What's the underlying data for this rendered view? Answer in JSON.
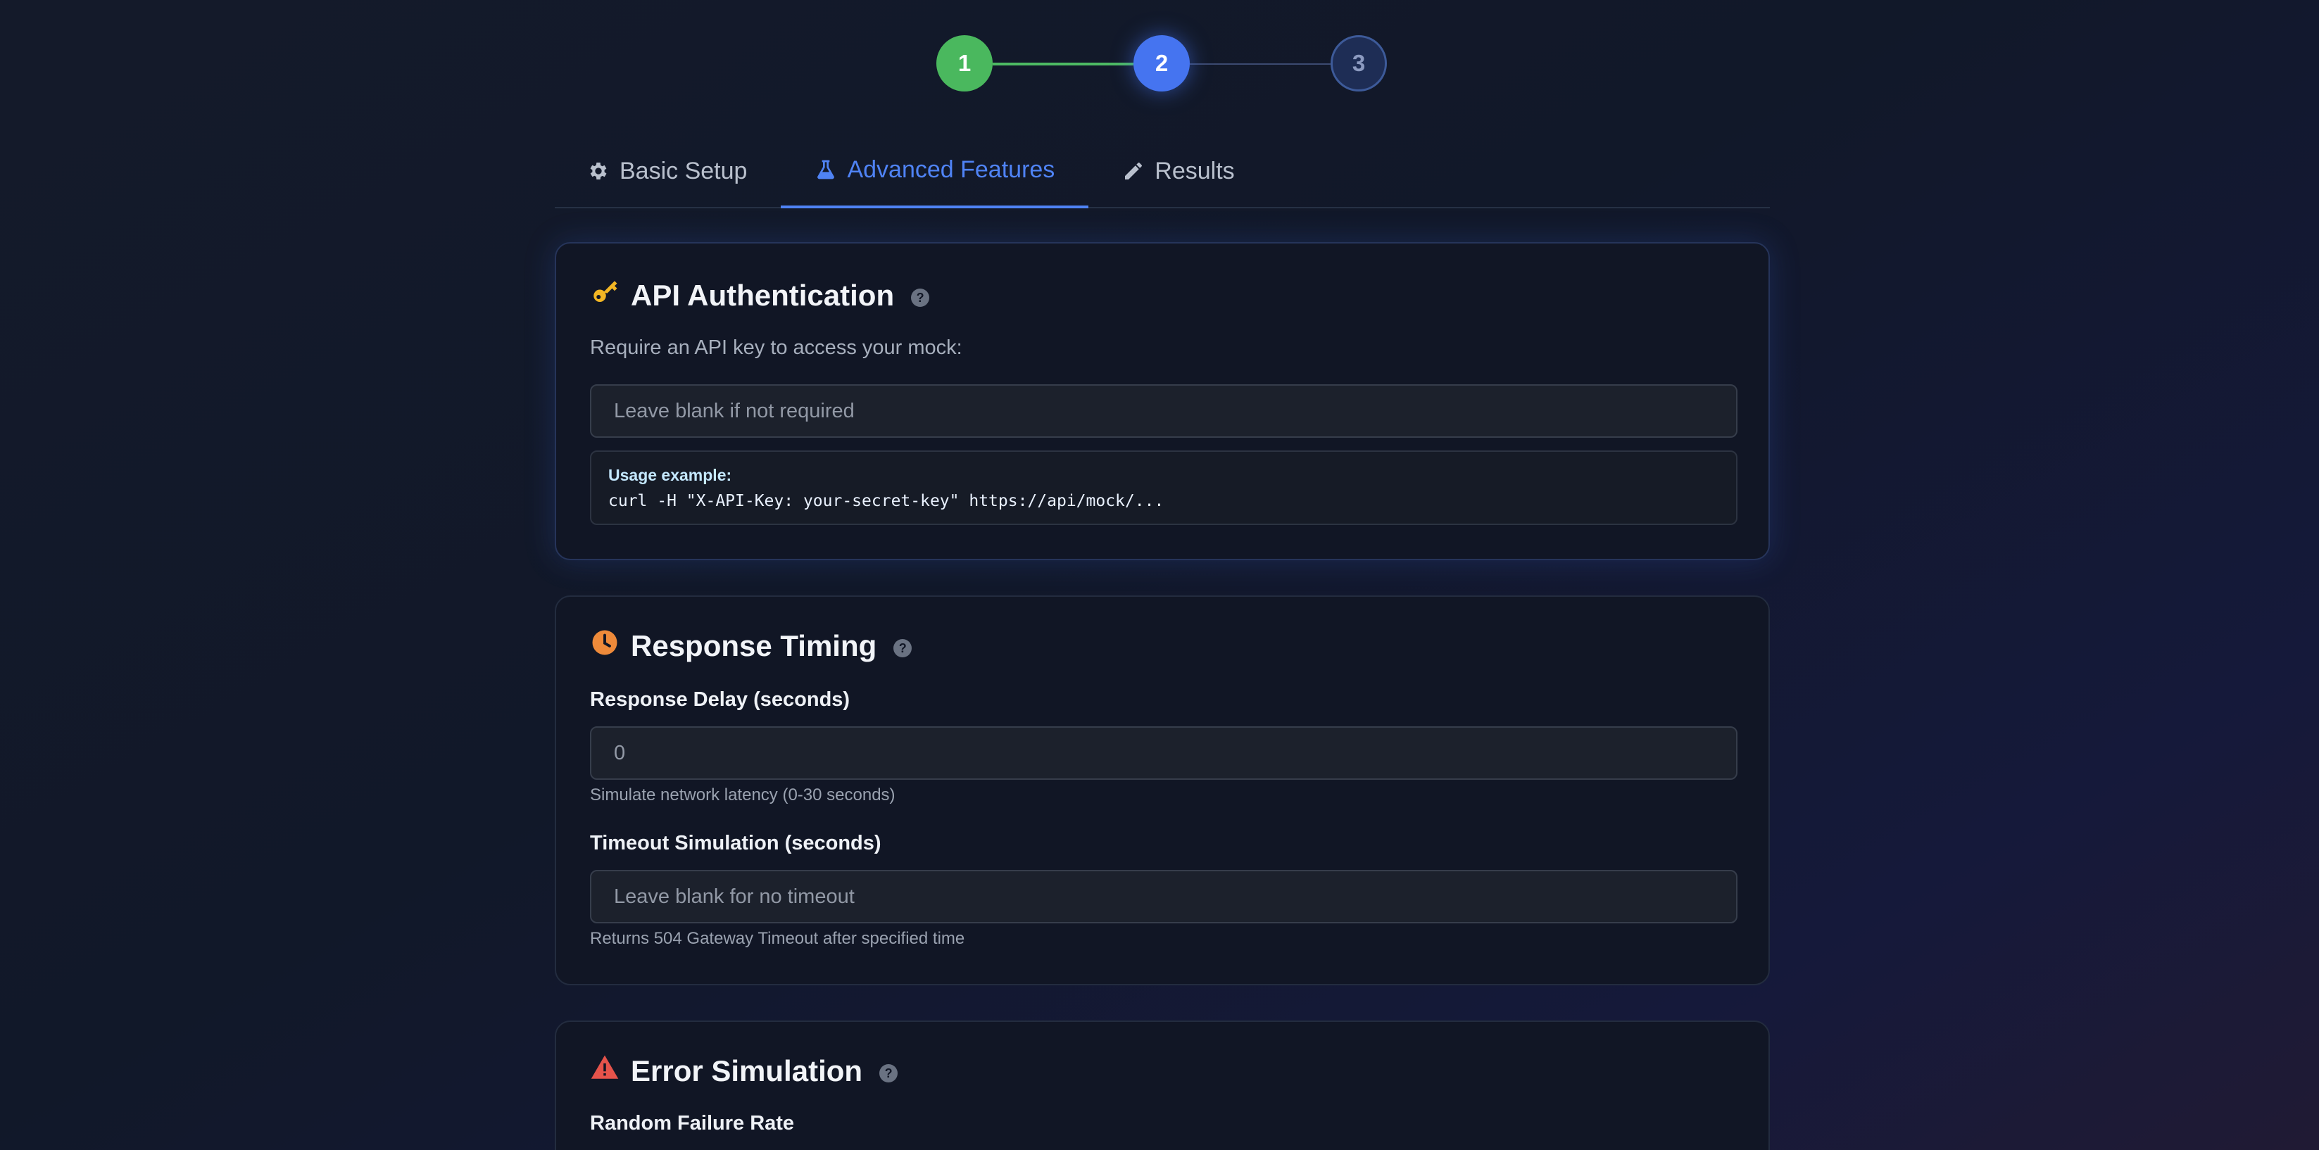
{
  "stepper": {
    "steps": [
      "1",
      "2",
      "3"
    ]
  },
  "tabs": [
    {
      "label": "Basic Setup",
      "icon": "gear-icon"
    },
    {
      "label": "Advanced Features",
      "icon": "flask-icon"
    },
    {
      "label": "Results",
      "icon": "pencil-icon"
    }
  ],
  "api_auth": {
    "title": "API Authentication",
    "description": "Require an API key to access your mock:",
    "input_placeholder": "Leave blank if not required",
    "usage_label": "Usage example:",
    "usage_code": "curl -H \"X-API-Key: your-secret-key\" https://api/mock/..."
  },
  "timing": {
    "title": "Response Timing",
    "delay_label": "Response Delay (seconds)",
    "delay_value": "0",
    "delay_hint": "Simulate network latency (0-30 seconds)",
    "timeout_label": "Timeout Simulation (seconds)",
    "timeout_placeholder": "Leave blank for no timeout",
    "timeout_hint": "Returns 504 Gateway Timeout after specified time"
  },
  "error_sim": {
    "title": "Error Simulation",
    "failure_label": "Random Failure Rate"
  },
  "colors": {
    "accent": "#4f83f5",
    "step_complete": "#4ab85e",
    "step_upcoming": "#1e2d55"
  }
}
